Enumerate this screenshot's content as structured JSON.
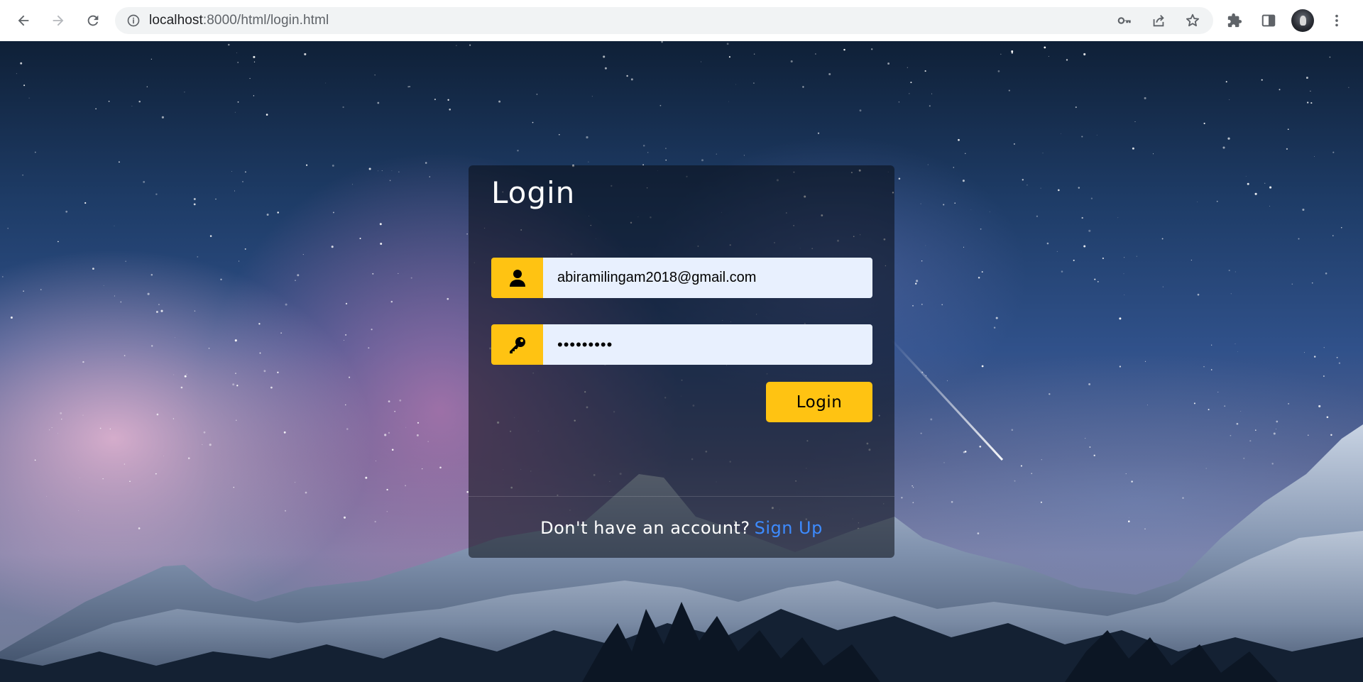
{
  "browser": {
    "url_host": "localhost",
    "url_rest": ":8000/html/login.html",
    "icons": [
      "back-icon",
      "forward-icon",
      "reload-icon",
      "site-info-icon",
      "password-key-icon",
      "share-icon",
      "bookmark-star-icon",
      "extensions-icon",
      "side-panel-icon",
      "profile-avatar",
      "more-menu-icon"
    ]
  },
  "login": {
    "title": "Login",
    "email_value": "abiramilingam2018@gmail.com",
    "password_value": "•••••••••",
    "button_label": "Login",
    "footer_text": "Don't have an account?",
    "signup_link": "Sign Up"
  },
  "colors": {
    "accent": "#ffc312",
    "link": "#3d8bff",
    "input_bg": "#e8f0fe",
    "card_bg": "rgba(10,12,20,0.55)"
  }
}
